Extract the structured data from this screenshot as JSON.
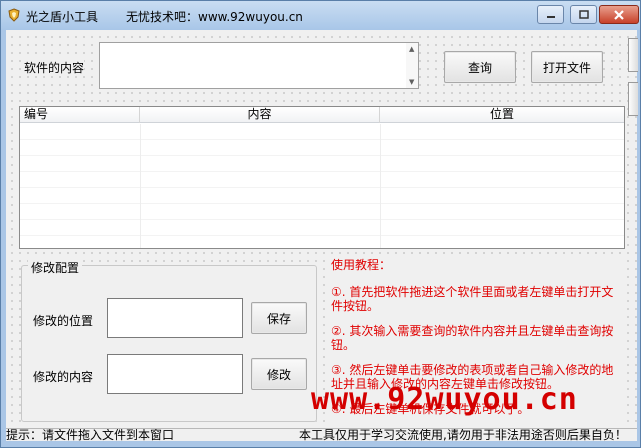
{
  "window": {
    "title": "光之盾小工具",
    "subtitle": "无忧技术吧：www.92wuyou.cn"
  },
  "top": {
    "content_label": "软件的内容",
    "content_value": "",
    "query_button": "查询",
    "open_file_button": "打开文件"
  },
  "list": {
    "columns": [
      "编号",
      "内容",
      "位置"
    ],
    "rows": []
  },
  "modify": {
    "group_title": "修改配置",
    "position_label": "修改的位置",
    "position_value": "",
    "save_button": "保存",
    "content_label": "修改的内容",
    "content_value": "",
    "modify_button": "修改"
  },
  "tutorial": {
    "title": "使用教程：",
    "steps": [
      "①. 首先把软件拖进这个软件里面或者左键单击打开文件按钮。",
      "②. 其次输入需要查询的软件内容并且左键单击查询按钮。",
      "③. 然后左键单击要修改的表项或者自己输入修改的地址并且输入修改的内容左键单击修改按钮。",
      "④. 最后左键单机保存文件就可以了。"
    ]
  },
  "watermark": "www.92wuyou.cn",
  "status": {
    "left": "提示：请文件拖入文件到本窗口",
    "right": "本工具仅用于学习交流使用,请勿用于非法用途否则后果自负！"
  },
  "colors": {
    "tutorial_text": "#e00000",
    "watermark": "#d40000",
    "title_bar": "#b8d1ec"
  }
}
